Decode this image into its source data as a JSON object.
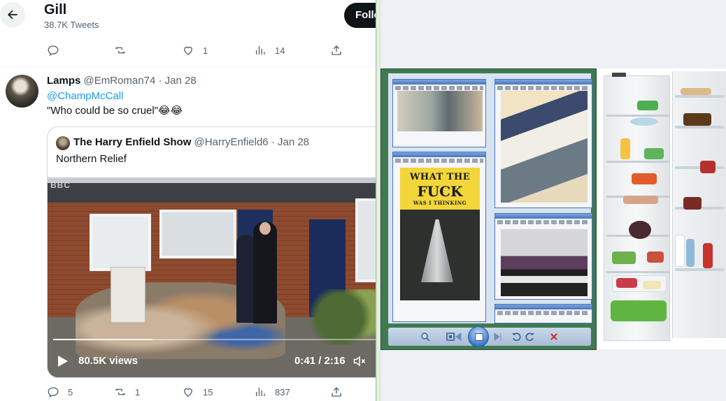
{
  "header": {
    "name": "Gill",
    "tweet_count": "38.7K Tweets",
    "follow_label": "Follow"
  },
  "first_actions": {
    "replies": "",
    "retweets": "",
    "likes": "1",
    "views": "14"
  },
  "tweet": {
    "author_name": "Lamps",
    "author_handle": "@EmRoman74",
    "date": "· Jan 28",
    "reply_to": "@ChampMcCall",
    "text": "\"Who could be so cruel\"😂😂",
    "actions": {
      "replies": "5",
      "retweets": "1",
      "likes": "15",
      "views": "837"
    }
  },
  "quote": {
    "author_name": "The Harry Enfield Show",
    "author_handle": "@HarryEnfield6",
    "date": "· Jan 28",
    "text": "Northern Relief",
    "video": {
      "channel_logo": "BBC",
      "views": "80.5K views",
      "time": "0:41 / 2:16",
      "progress": 0.3
    }
  },
  "photo_viewer": {
    "poster_line1": "WHAT THE",
    "poster_line2": "FUCK",
    "poster_line3": "WAS I THINKING"
  },
  "icons": {
    "back": "arrow-left-icon",
    "reply": "reply-icon",
    "retweet": "retweet-icon",
    "like": "heart-icon",
    "views": "bar-chart-icon",
    "share": "share-icon",
    "play": "play-icon",
    "volume": "volume-icon"
  },
  "colors": {
    "link": "#1d9bf0",
    "muted": "#536471",
    "text": "#0f1419",
    "follow_bg": "#0f1419"
  }
}
